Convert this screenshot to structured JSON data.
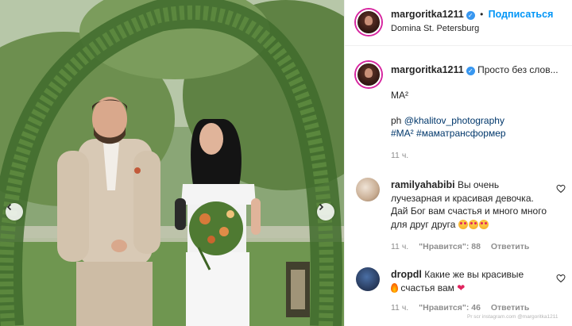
{
  "post": {
    "author": "margoritka1211",
    "follow_label": "Подписаться",
    "separator": "•",
    "location": "Domina St. Petersburg"
  },
  "caption": {
    "author": "margoritka1211",
    "text": "Просто без слов...",
    "line2": "МА²",
    "line3_prefix": "ph ",
    "line3_link": "@khalitov_photography",
    "line4_tag1": "#МА²",
    "line4_tag2": "#маматрансформер",
    "time": "11 ч."
  },
  "comments": [
    {
      "author": "ramilyahabibi",
      "text": "Вы очень лучезарная и красивая девочка. Дай Бог вам счастья и много много для друг друга",
      "time": "11 ч.",
      "likes": "\"Нравится\": 88",
      "reply": "Ответить"
    },
    {
      "author": "dropdl",
      "text": "Какие же вы красивые",
      "text2": "счастья вам",
      "time": "11 ч.",
      "likes": "\"Нравится\": 46",
      "reply": "Ответить"
    }
  ],
  "watermark": "Pr scr instagram.com @margoritka1211",
  "colors": {
    "link": "#00376b",
    "follow": "#0095f6",
    "verified": "#3897f0"
  }
}
